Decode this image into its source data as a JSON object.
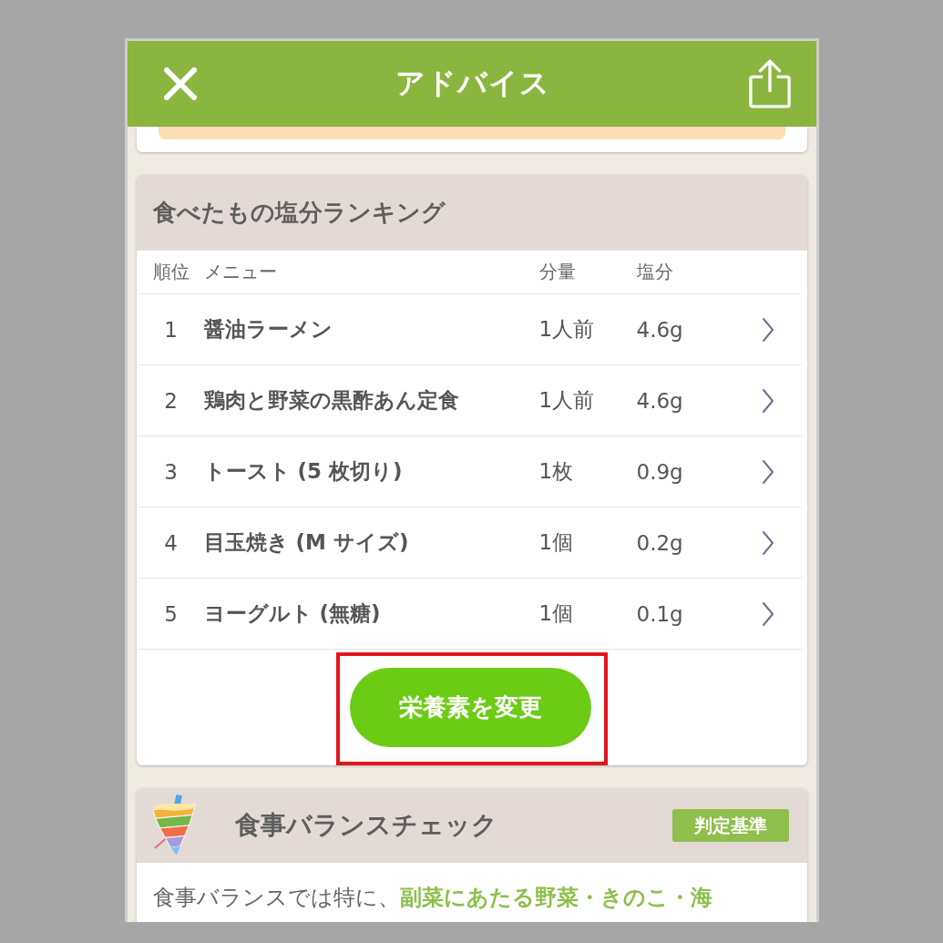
{
  "header": {
    "title": "アドバイス"
  },
  "ranking": {
    "title": "食べたもの塩分ランキング",
    "columns": [
      "順位",
      "メニュー",
      "分量",
      "塩分"
    ],
    "rows": [
      {
        "rank": "1",
        "menu": "醤油ラーメン",
        "amount": "1人前",
        "salt": "4.6g"
      },
      {
        "rank": "2",
        "menu": "鶏肉と野菜の黒酢あん定食",
        "amount": "1人前",
        "salt": "4.6g"
      },
      {
        "rank": "3",
        "menu": "トースト (5 枚切り)",
        "amount": "1枚",
        "salt": "0.9g"
      },
      {
        "rank": "4",
        "menu": "目玉焼き (M サイズ)",
        "amount": "1個",
        "salt": "0.2g"
      },
      {
        "rank": "5",
        "menu": "ヨーグルト (無糖)",
        "amount": "1個",
        "salt": "0.1g"
      }
    ],
    "button": {
      "label": "栄養素を変更",
      "highlighted": true
    }
  },
  "balance_check": {
    "title": "食事バランスチェック",
    "criteria_button": "判定基準",
    "text": "食事バランスでは特に、**副菜にあたる野菜・きのこ・海**"
  }
}
